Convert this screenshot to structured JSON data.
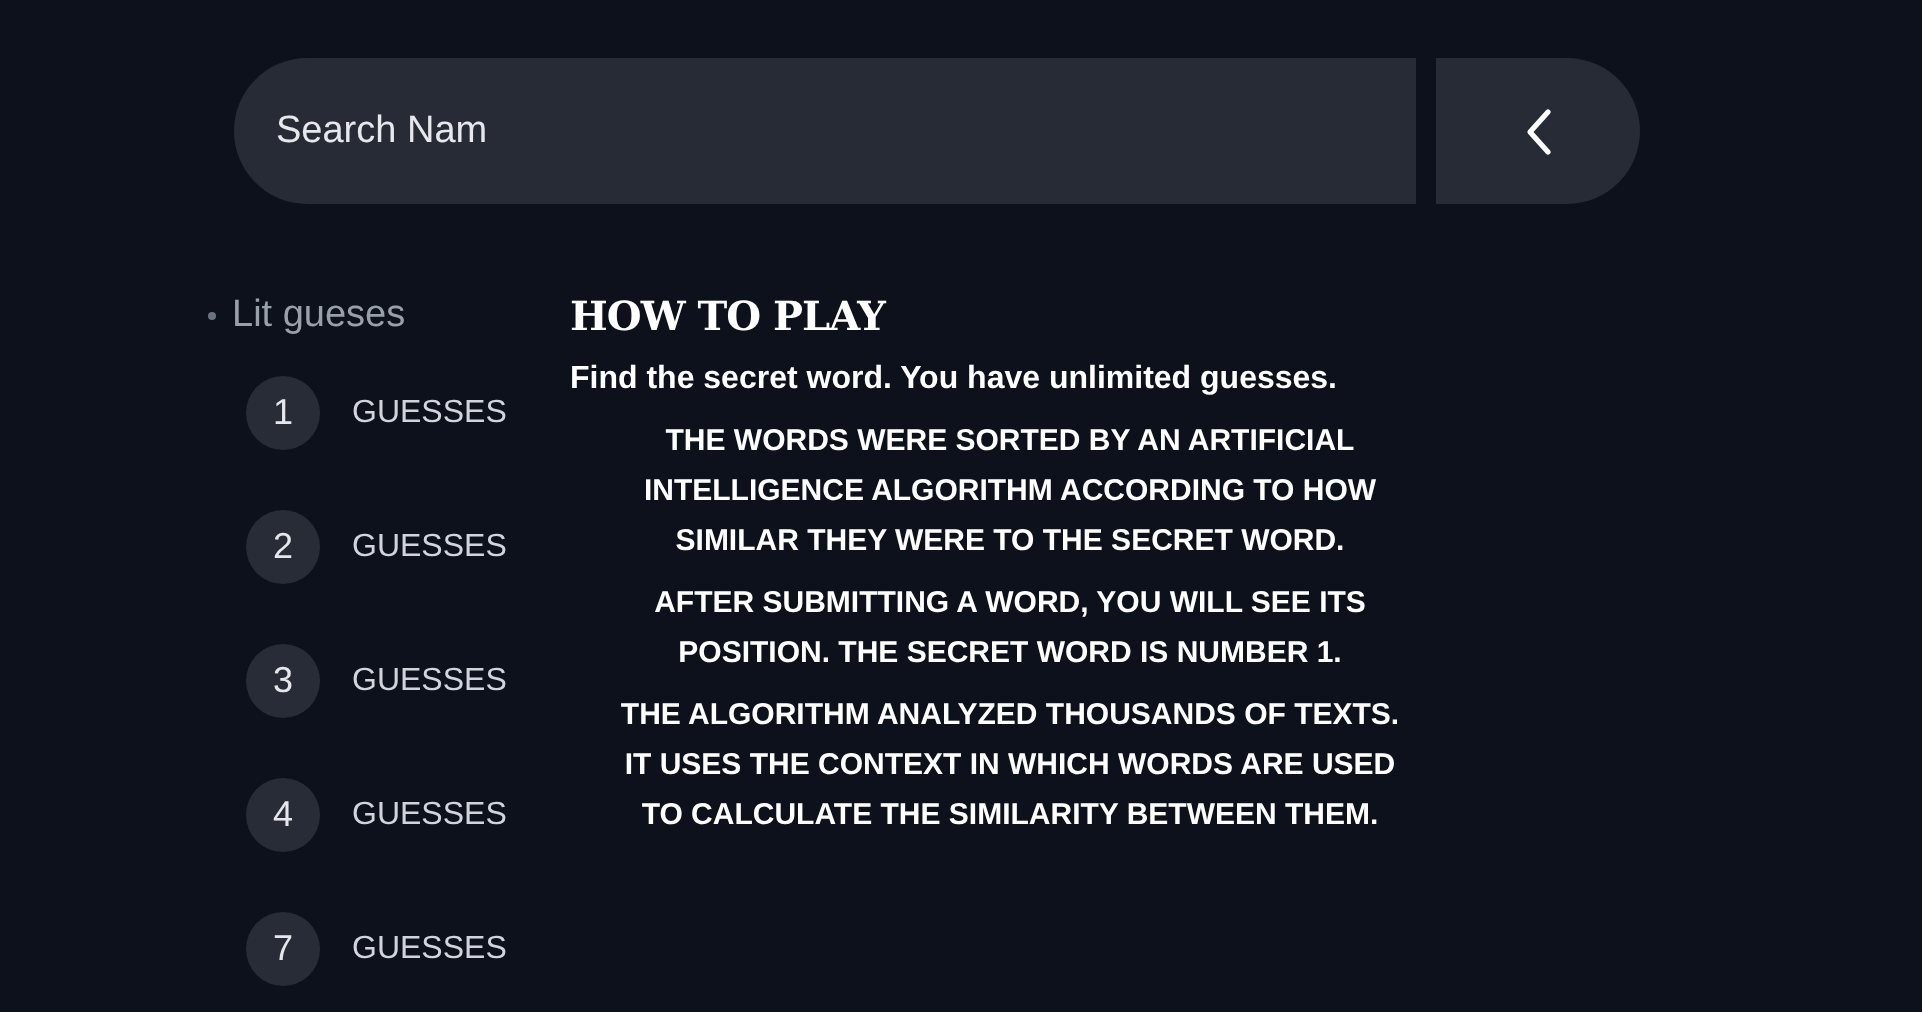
{
  "search": {
    "placeholder": "Search Nam"
  },
  "guesses": {
    "heading": "Lit gueses",
    "items": [
      {
        "number": "1",
        "label": "GUESSES"
      },
      {
        "number": "2",
        "label": "GUESSES"
      },
      {
        "number": "3",
        "label": "GUESSES"
      },
      {
        "number": "4",
        "label": "GUESSES"
      },
      {
        "number": "7",
        "label": "GUESSES"
      }
    ]
  },
  "how_to_play": {
    "title": "HOW TO PLAY",
    "intro": "Find the secret word. You have unlimited guesses.",
    "paragraphs": [
      {
        "lines": [
          "THE WORDS WERE SORTED BY AN ARTIFICIAL",
          "INTELLIGENCE ALGORITHM ACCORDING TO HOW",
          "SIMILAR THEY WERE TO THE SECRET WORD."
        ]
      },
      {
        "lines": [
          "AFTER SUBMITTING A WORD, YOU WILL SEE ITS",
          "POSITION. THE SECRET WORD IS NUMBER 1."
        ]
      },
      {
        "lines": [
          "THE ALGORITHM ANALYZED THOUSANDS OF TEXTS.",
          "IT USES THE CONTEXT IN WHICH WORDS ARE USED",
          "TO CALCULATE THE SIMILARITY BETWEEN THEM."
        ]
      }
    ]
  }
}
